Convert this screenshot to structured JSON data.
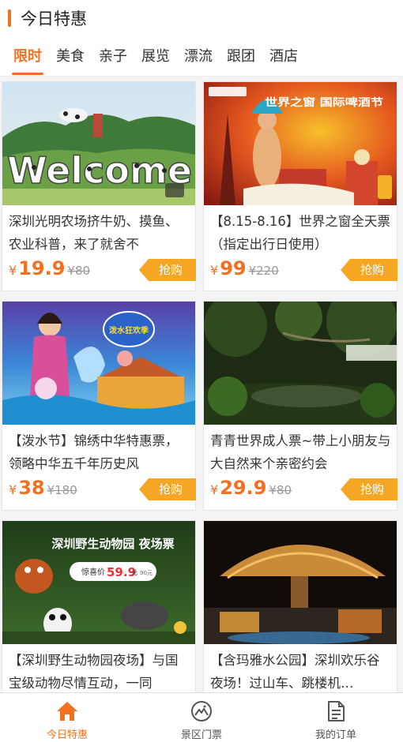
{
  "header": {
    "title": "今日特惠"
  },
  "tabs": [
    {
      "label": "限时"
    },
    {
      "label": "美食"
    },
    {
      "label": "亲子"
    },
    {
      "label": "展览"
    },
    {
      "label": "漂流"
    },
    {
      "label": "跟团"
    },
    {
      "label": "酒店"
    }
  ],
  "cards": [
    {
      "title": "深圳光明农场挤牛奶、摸鱼、农业科普，来了就舍不",
      "currency": "¥",
      "price": "19.9",
      "original": "¥80",
      "buy_label": "抢购",
      "image": "farm-welcome-sign",
      "image_text": "Welcome"
    },
    {
      "title": "【8.15-8.16】世界之窗全天票（指定出行日使用）",
      "currency": "¥",
      "price": "99",
      "original": "¥220",
      "buy_label": "抢购",
      "image": "beer-festival-poster",
      "image_text": "世界之窗 国际啤酒节"
    },
    {
      "title": "【泼水节】锦绣中华特惠票，领略中华五千年历史风",
      "currency": "¥",
      "price": "38",
      "original": "¥180",
      "buy_label": "抢购",
      "image": "water-festival-poster",
      "image_text": "泼水狂欢季"
    },
    {
      "title": "青青世界成人票~带上小朋友与大自然来个亲密约会",
      "currency": "¥",
      "price": "29.9",
      "original": "¥80",
      "buy_label": "抢购",
      "image": "forest-bridge-photo"
    },
    {
      "title": "【深圳野生动物园夜场】与国宝级动物尽情互动，一同",
      "currency": "¥",
      "price": "",
      "original": "",
      "buy_label": "",
      "image": "night-zoo-poster",
      "image_text": "深圳野生动物园 夜场票",
      "image_price_label": "惊喜价",
      "image_price": "59.9",
      "image_price_unit": "元",
      "image_orig": "90元"
    },
    {
      "title": "【含玛雅水公园】深圳欢乐谷夜场！过山车、跳楼机…",
      "currency": "¥",
      "price": "",
      "original": "",
      "buy_label": "",
      "image": "thatched-pavilion-night"
    }
  ],
  "tabbar": [
    {
      "label": "今日特惠",
      "icon": "home-icon",
      "active": true
    },
    {
      "label": "景区门票",
      "icon": "mountain-ticket-icon",
      "active": false
    },
    {
      "label": "我的订单",
      "icon": "order-list-icon",
      "active": false
    }
  ],
  "colors": {
    "accent": "#f37021",
    "buy_button": "#f5a623"
  }
}
